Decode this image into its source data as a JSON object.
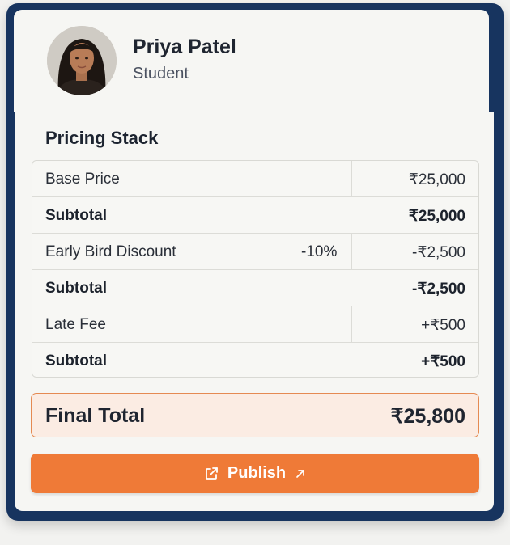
{
  "user": {
    "name": "Priya Patel",
    "role": "Student"
  },
  "pricing": {
    "title": "Pricing Stack",
    "rows": [
      {
        "label": "Base Price",
        "amount": "₹25,000"
      },
      {
        "label": "Subtotal",
        "amount": "₹25,000"
      },
      {
        "label": "Early Bird Discount",
        "percent": "-10%",
        "amount": "-₹2,500"
      },
      {
        "label": "Subtotal",
        "amount": "-₹2,500"
      },
      {
        "label": "Late Fee",
        "amount": "+₹500"
      },
      {
        "label": "Subtotal",
        "amount": "+₹500"
      }
    ],
    "final_label": "Final Total",
    "final_value": "₹25,800"
  },
  "actions": {
    "publish_label": "Publish"
  },
  "colors": {
    "frame": "#17345f",
    "accent": "#ef7a37",
    "total_bg": "#fbece3"
  },
  "icons": {
    "publish": "external-link-icon",
    "arrow": "arrow-up-right-icon"
  }
}
